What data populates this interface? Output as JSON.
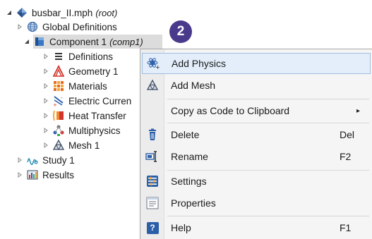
{
  "tree": {
    "root": {
      "label": "busbar_II.mph",
      "suffix": "(root)"
    },
    "global_definitions": {
      "label": "Global Definitions"
    },
    "component": {
      "label": "Component 1",
      "suffix": "(comp1)"
    },
    "children": [
      {
        "label": "Definitions"
      },
      {
        "label": "Geometry 1"
      },
      {
        "label": "Materials"
      },
      {
        "label": "Electric Curren"
      },
      {
        "label": "Heat Transfer"
      },
      {
        "label": "Multiphysics"
      },
      {
        "label": "Mesh 1"
      }
    ],
    "study": {
      "label": "Study 1"
    },
    "results": {
      "label": "Results"
    }
  },
  "callout": {
    "number": "2"
  },
  "context_menu": {
    "items": [
      {
        "label": "Add Physics",
        "icon": "add-physics-icon",
        "shortcut": ""
      },
      {
        "label": "Add Mesh",
        "icon": "add-mesh-icon",
        "shortcut": ""
      },
      {
        "label": "Copy as Code to Clipboard",
        "icon": "",
        "shortcut": "",
        "submenu_arrow": "▸"
      },
      {
        "label": "Delete",
        "icon": "delete-icon",
        "shortcut": "Del"
      },
      {
        "label": "Rename",
        "icon": "rename-icon",
        "shortcut": "F2"
      },
      {
        "label": "Settings",
        "icon": "settings-icon",
        "shortcut": ""
      },
      {
        "label": "Properties",
        "icon": "properties-icon",
        "shortcut": ""
      },
      {
        "label": "Help",
        "icon": "help-icon",
        "shortcut": "F1",
        "icon_text": "?"
      }
    ]
  },
  "colors": {
    "highlight_bg": "#e3eefa",
    "highlight_border": "#9fbfe3",
    "callout_bg": "#4a3a8c",
    "selection_bg": "#dcdcdc"
  }
}
